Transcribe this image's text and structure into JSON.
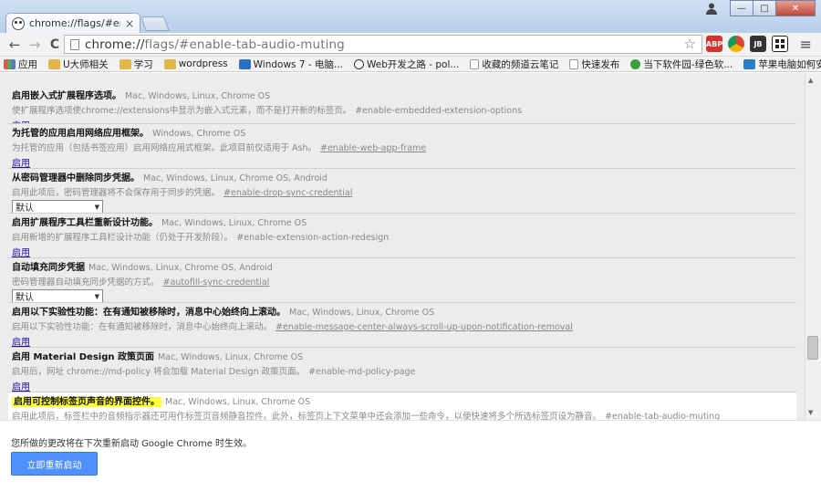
{
  "window": {
    "tab_title": "chrome://flags/#enable",
    "tab_close": "×",
    "buttons": {
      "minimize": "—",
      "maximize": "□",
      "close": "✕"
    },
    "user_icon": "person-icon"
  },
  "toolbar": {
    "back": "←",
    "forward": "→",
    "reload": "C",
    "url_host": "chrome://",
    "url_path": "flags/#enable-tab-audio-muting",
    "star": "☆",
    "menu": "≡",
    "extensions": [
      {
        "name": "abp",
        "label": "ABP",
        "color": "#d9322c"
      },
      {
        "name": "chrome-colors",
        "label": "",
        "color": "#3b9c3e"
      },
      {
        "name": "jb",
        "label": "JB",
        "color": "#333333"
      },
      {
        "name": "grid",
        "label": "",
        "color": "#222222"
      },
      {
        "name": "emoji",
        "label": "☺",
        "color": "#e56b1f"
      }
    ]
  },
  "bookmarks": {
    "items": [
      {
        "label": "应用",
        "type": "apps"
      },
      {
        "label": "U大师相关",
        "type": "folder"
      },
      {
        "label": "学习",
        "type": "folder"
      },
      {
        "label": "wordpress",
        "type": "folder"
      },
      {
        "label": "Windows 7 - 电脑...",
        "type": "page"
      },
      {
        "label": "Web开发之路 - pol...",
        "type": "page"
      },
      {
        "label": "收藏的频道云笔记",
        "type": "page"
      },
      {
        "label": "快速发布",
        "type": "page"
      },
      {
        "label": "当下软件园-绿色软...",
        "type": "page"
      },
      {
        "label": "苹果电脑如何安装...",
        "type": "page"
      }
    ],
    "more": "»"
  },
  "flags": [
    {
      "name": "启用嵌入式扩展程序选项。",
      "platforms": "Mac, Windows, Linux, Chrome OS",
      "desc": "使扩展程序选项使chrome://extensions中显示为嵌入式元素，而不是打开新的标签页。",
      "id": "#enable-embedded-extension-options",
      "id_underline": false,
      "action": "link",
      "action_label": "启用"
    },
    {
      "name": "为托管的应用启用网络应用框架。",
      "platforms": "Windows, Chrome OS",
      "desc": "为托管的应用（包括书签应用）启用网络应用式框架。此项目前仅适用于 Ash。",
      "id": "#enable-web-app-frame",
      "id_underline": true,
      "action": "link",
      "action_label": "启用"
    },
    {
      "name": "从密码管理器中删除同步凭据。",
      "platforms": "Mac, Windows, Linux, Chrome OS, Android",
      "desc": "启用此项后，密码管理器将不会保存用于同步的凭据。",
      "id": "#enable-drop-sync-credential",
      "id_underline": true,
      "action": "select",
      "action_label": "默认"
    },
    {
      "name": "启用扩展程序工具栏重新设计功能。",
      "platforms": "Mac, Windows, Linux, Chrome OS",
      "desc": "启用新增的扩展程序工具栏设计功能（仍处于开发阶段）。",
      "id": "#enable-extension-action-redesign",
      "id_underline": false,
      "action": "link",
      "action_label": "启用"
    },
    {
      "name": "自动填充同步凭据",
      "platforms": "Mac, Windows, Linux, Chrome OS, Android",
      "desc": "密码管理器自动填充同步凭据的方式。",
      "id": "#autofill-sync-credential",
      "id_underline": true,
      "action": "select",
      "action_label": "默认"
    },
    {
      "name": "启用以下实验性功能：在有通知被移除时，消息中心始终向上滚动。",
      "platforms": "Mac, Windows, Linux, Chrome OS",
      "desc": "启用以下实验性功能：在有通知被移除时，消息中心始终向上滚动。",
      "id": "#enable-message-center-always-scroll-up-upon-notification-removal",
      "id_underline": true,
      "action": "link",
      "action_label": "启用"
    },
    {
      "name": "启用 Material Design 政策页面",
      "platforms": "Mac, Windows, Linux, Chrome OS",
      "desc": "启用后，网址 chrome://md-policy 将会加载 Material Design 政策页面。",
      "id": "#enable-md-policy-page",
      "id_underline": false,
      "action": "link",
      "action_label": "启用"
    },
    {
      "name": "启用可控制标签页声音的界面控件。",
      "platforms": "Mac, Windows, Linux, Chrome OS",
      "desc": "启用此项后，标签栏中的音频指示器还可用作标签页音频静音控件。此外，标签页上下文菜单中还会添加一些命令，以便快速将多个所选标签页设为静音。",
      "id": "#enable-tab-audio-muting",
      "id_underline": true,
      "action": "none",
      "action_label": "",
      "highlight": true
    }
  ],
  "footer": {
    "message": "您所做的更改将在下次重新启动 Google Chrome 时生效。",
    "relaunch_label": "立即重新启动"
  },
  "scrollbar": {
    "up": "▲",
    "down": "▼"
  }
}
